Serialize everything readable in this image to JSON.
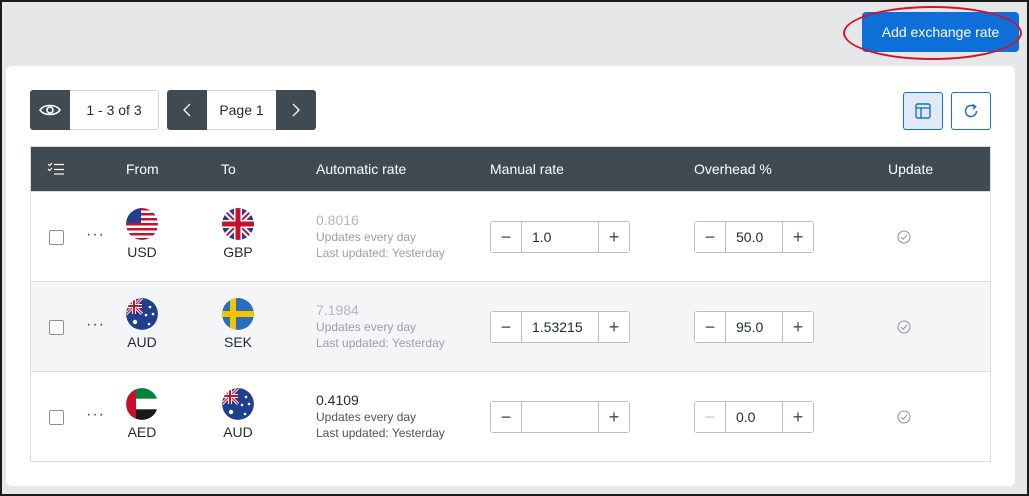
{
  "toolbar": {
    "add_label": "Add exchange rate",
    "view_count": "1 - 3 of 3",
    "page_label": "Page 1"
  },
  "icons": {
    "view": "eye-icon",
    "prev": "chevron-left-icon",
    "next": "chevron-right-icon",
    "layout": "layout-icon",
    "refresh": "refresh-icon",
    "bulk": "checklist-icon",
    "update": "check-circle-icon"
  },
  "colors": {
    "primary": "#0f6fd8",
    "header": "#3f4a52",
    "annotation": "#d0142c"
  },
  "table": {
    "headers": {
      "from": "From",
      "to": "To",
      "automatic": "Automatic rate",
      "manual": "Manual rate",
      "overhead": "Overhead %",
      "update": "Update"
    },
    "rows": [
      {
        "from": "USD",
        "to": "GBP",
        "rate": "0.8016",
        "rate_muted": true,
        "freq": "Updates every day",
        "last": "Last updated: Yesterday",
        "manual": "1.0",
        "overhead": "50.0",
        "overhead_minus_enabled": true
      },
      {
        "from": "AUD",
        "to": "SEK",
        "rate": "7.1984",
        "rate_muted": true,
        "freq": "Updates every day",
        "last": "Last updated: Yesterday",
        "manual": "1.53215",
        "overhead": "95.0",
        "overhead_minus_enabled": true
      },
      {
        "from": "AED",
        "to": "AUD",
        "rate": "0.4109",
        "rate_muted": false,
        "freq": "Updates every day",
        "last": "Last updated: Yesterday",
        "manual": "",
        "overhead": "0.0",
        "overhead_minus_enabled": false
      }
    ]
  }
}
